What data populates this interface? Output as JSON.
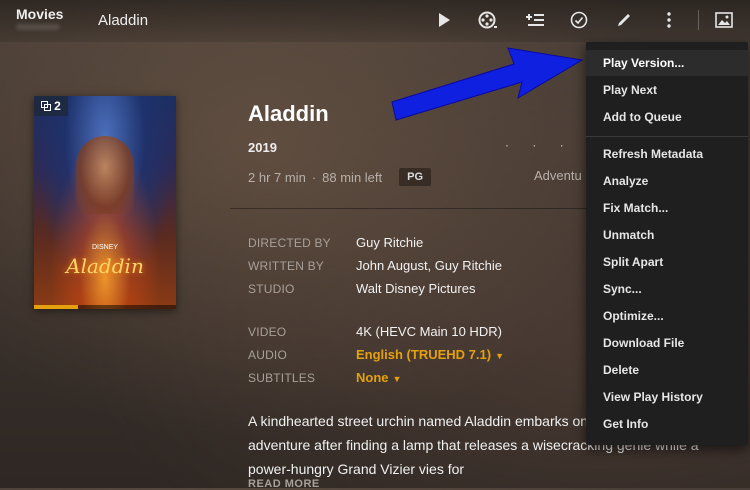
{
  "topbar": {
    "section": "Movies",
    "title": "Aladdin",
    "icons": [
      "play-icon",
      "film-reel-icon",
      "add-to-queue-icon",
      "check-circle-icon",
      "pencil-icon",
      "more-vertical-icon",
      "image-icon"
    ]
  },
  "poster": {
    "versions_count": "2",
    "logo_text": "Aladdin",
    "studio_mark": "DISNEY",
    "progress": 0.31
  },
  "details": {
    "title": "Aladdin",
    "year": "2019",
    "duration": "2 hr 7 min",
    "separator": "·",
    "time_left": "88 min left",
    "rating": "PG",
    "rating_dots": "· · · · ·",
    "genre": "Adventu",
    "credits": [
      {
        "label": "DIRECTED BY",
        "value": "Guy Ritchie"
      },
      {
        "label": "WRITTEN BY",
        "value": "John August, Guy Ritchie"
      },
      {
        "label": "STUDIO",
        "value": "Walt Disney Pictures"
      }
    ],
    "media": [
      {
        "label": "VIDEO",
        "value": "4K (HEVC Main 10 HDR)"
      },
      {
        "label": "AUDIO",
        "value": "English (TRUEHD 7.1)"
      },
      {
        "label": "SUBTITLES",
        "value": "None"
      }
    ],
    "summary": "A kindhearted street urchin named Aladdin embarks on a magical adventure after finding a lamp that releases a wisecracking genie while a power-hungry Grand Vizier vies for",
    "read_more": "READ MORE"
  },
  "menu": {
    "items": [
      "Play Version...",
      "Play Next",
      "Add to Queue",
      "Refresh Metadata",
      "Analyze",
      "Fix Match...",
      "Unmatch",
      "Split Apart",
      "Sync...",
      "Optimize...",
      "Download File",
      "Delete",
      "View Play History",
      "Get Info"
    ]
  },
  "colors": {
    "accent": "#e5a00d",
    "menu_bg": "#1f1f1f",
    "arrow": "#1020e0"
  }
}
